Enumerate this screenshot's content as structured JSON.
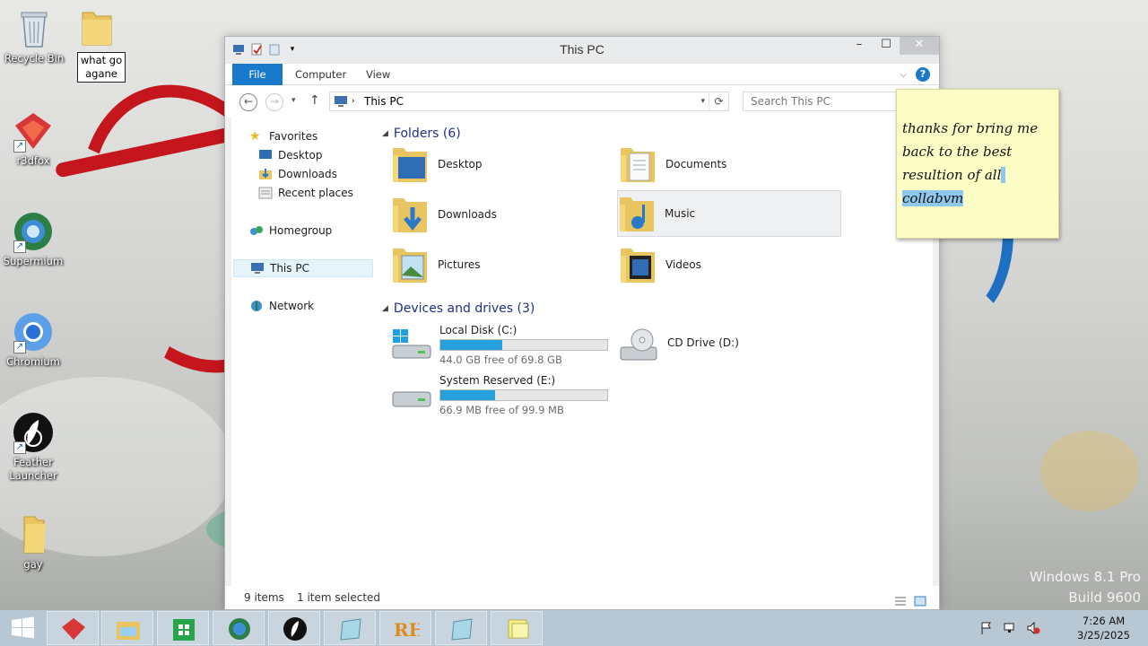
{
  "desktop": {
    "icons": [
      {
        "label": "Recycle Bin"
      },
      {
        "label": "r3dfox"
      },
      {
        "label": "Supermium"
      },
      {
        "label": "Chromium"
      },
      {
        "label": "Feather Launcher"
      },
      {
        "label": "gay"
      }
    ],
    "rename_text": "what go agane",
    "watermark_line1": "Windows 8.1 Pro",
    "watermark_line2": "Build 9600"
  },
  "window": {
    "title": "This PC",
    "ribbon_tabs": [
      "File",
      "Computer",
      "View"
    ],
    "address": "This PC",
    "search_placeholder": "Search This PC",
    "nav": {
      "favorites": "Favorites",
      "desktop": "Desktop",
      "downloads": "Downloads",
      "recent": "Recent places",
      "homegroup": "Homegroup",
      "thispc": "This PC",
      "network": "Network"
    },
    "folders_header": "Folders (6)",
    "folders": [
      "Desktop",
      "Documents",
      "Downloads",
      "Music",
      "Pictures",
      "Videos"
    ],
    "devices_header": "Devices and drives (3)",
    "drives": [
      {
        "name": "Local Disk (C:)",
        "free_text": "44.0 GB free of 69.8 GB",
        "used_fraction": 0.37
      },
      {
        "name": "CD Drive (D:)"
      },
      {
        "name": "System Reserved (E:)",
        "free_text": "66.9 MB free of 99.9 MB",
        "used_fraction": 0.33
      }
    ],
    "status_items": "9 items",
    "status_selected": "1 item selected"
  },
  "sticky_note": {
    "line1": "thanks for bring me",
    "line2": "back to the best",
    "line3": "resultion of all",
    "line4": "collabvm"
  },
  "taskbar": {
    "time": "7:26 AM",
    "date": "3/25/2025",
    "items": [
      "r3dfox",
      "File Explorer",
      "Store",
      "Supermium",
      "Feather Launcher",
      "window",
      "RH",
      "window",
      "Sticky Notes"
    ]
  },
  "colors": {
    "accent": "#1979ca",
    "drive_bar": "#26a0da",
    "note": "#fdfdc6"
  }
}
